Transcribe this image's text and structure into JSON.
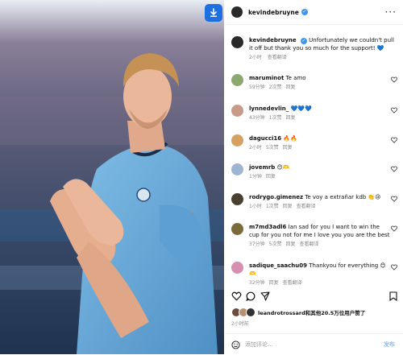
{
  "post": {
    "author": "kevindebruyne",
    "caption_text": "Unfortunately we couldn't pull it off but thank you so much for the support! 💙",
    "caption_time": "2小时",
    "see_translation": "查看翻译"
  },
  "comments": [
    {
      "user": "maruminot",
      "text": "Te amo",
      "time": "59分钟",
      "likes": "2次赞",
      "reply": "回复",
      "translate": ""
    },
    {
      "user": "lynnedevlin_",
      "text": "💙💙💙",
      "time": "43分钟",
      "likes": "1次赞",
      "reply": "回复",
      "translate": ""
    },
    {
      "user": "dagucci16",
      "text": "🔥🔥",
      "time": "2小时",
      "likes": "5次赞",
      "reply": "回复",
      "translate": ""
    },
    {
      "user": "jovemrb",
      "text": "😊🫶",
      "time": "1分钟",
      "likes": "",
      "reply": "回复",
      "translate": ""
    },
    {
      "user": "rodrygo.gimenez",
      "text": "Te voy a extrañar kdb 👏😢",
      "time": "1小时",
      "likes": "1次赞",
      "reply": "回复",
      "translate": "查看翻译"
    },
    {
      "user": "m7md3adl6",
      "text": "Ian sad for you I want to win the cup for you not for me I love you you are the best",
      "time": "37分钟",
      "likes": "5次赞",
      "reply": "回复",
      "translate": "查看翻译"
    },
    {
      "user": "sadique_saachu09",
      "text": "Thankyou for everything 😊🫶",
      "time": "32分钟",
      "likes": "",
      "reply": "回复",
      "translate": "查看翻译"
    }
  ],
  "likes_line": "leandrotrossard和其他20.5万位用户赞了",
  "post_time": "2小时前",
  "comment_input": {
    "placeholder": "添加评论...",
    "post_label": "发布"
  },
  "icons": [
    "more-icon",
    "heart-icon",
    "comment-icon",
    "share-icon",
    "bookmark-icon",
    "emoji-icon",
    "download-icon"
  ],
  "colors": {
    "verified": "#3897f0",
    "badge": "#1e6fe0",
    "jersey": "#6cabdd"
  }
}
